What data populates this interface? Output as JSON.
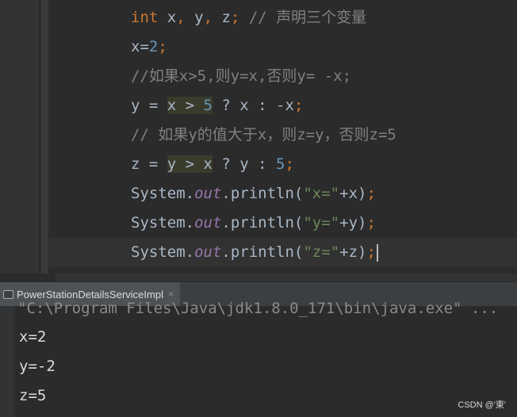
{
  "editor": {
    "lines": [
      {
        "parts": [
          [
            "kw",
            "int"
          ],
          [
            "p",
            " x"
          ],
          [
            "kw",
            ","
          ],
          [
            "p",
            " y"
          ],
          [
            "kw",
            ","
          ],
          [
            "p",
            " z"
          ],
          [
            "kw",
            ";"
          ],
          [
            "p",
            " "
          ],
          [
            "cmt",
            "// 声明三个变量"
          ]
        ]
      },
      {
        "parts": [
          [
            "p",
            "x="
          ],
          [
            "num",
            "2"
          ],
          [
            "kw",
            ";"
          ]
        ]
      },
      {
        "parts": [
          [
            "cmt",
            "//如果x>5,则y=x,否则y= -x;"
          ]
        ]
      },
      {
        "parts": [
          [
            "p",
            "y = "
          ],
          [
            "hl",
            "x > "
          ],
          [
            "hln",
            "5"
          ],
          [
            "p",
            " ? x : -x"
          ],
          [
            "kw",
            ";"
          ]
        ]
      },
      {
        "parts": [
          [
            "cmt",
            "// 如果y的值大于x，则z=y，否则z=5"
          ]
        ]
      },
      {
        "parts": [
          [
            "p",
            "z = "
          ],
          [
            "hl",
            "y > x"
          ],
          [
            "p",
            " ? y : "
          ],
          [
            "num",
            "5"
          ],
          [
            "kw",
            ";"
          ]
        ]
      },
      {
        "parts": [
          [
            "p",
            "System."
          ],
          [
            "fld",
            "out"
          ],
          [
            "p",
            ".println("
          ],
          [
            "str",
            "\"x=\""
          ],
          [
            "p",
            "+x)"
          ],
          [
            "kw",
            ";"
          ]
        ]
      },
      {
        "parts": [
          [
            "p",
            "System."
          ],
          [
            "fld",
            "out"
          ],
          [
            "p",
            ".println("
          ],
          [
            "str",
            "\"y=\""
          ],
          [
            "p",
            "+y)"
          ],
          [
            "kw",
            ";"
          ]
        ]
      },
      {
        "parts": [
          [
            "p",
            "System."
          ],
          [
            "fld",
            "out"
          ],
          [
            "p",
            ".println("
          ],
          [
            "str",
            "\"z=\""
          ],
          [
            "p",
            "+z)"
          ],
          [
            "kw",
            ";"
          ]
        ]
      }
    ]
  },
  "run_panel": {
    "tab_label": "PowerStationDetailsServiceImpl",
    "tab_close": "×",
    "command": "\"C:\\Program Files\\Java\\jdk1.8.0_171\\bin\\java.exe\" ...",
    "output": [
      "x=2",
      "y=-2",
      "z=5"
    ]
  },
  "watermark": "CSDN @'東'"
}
